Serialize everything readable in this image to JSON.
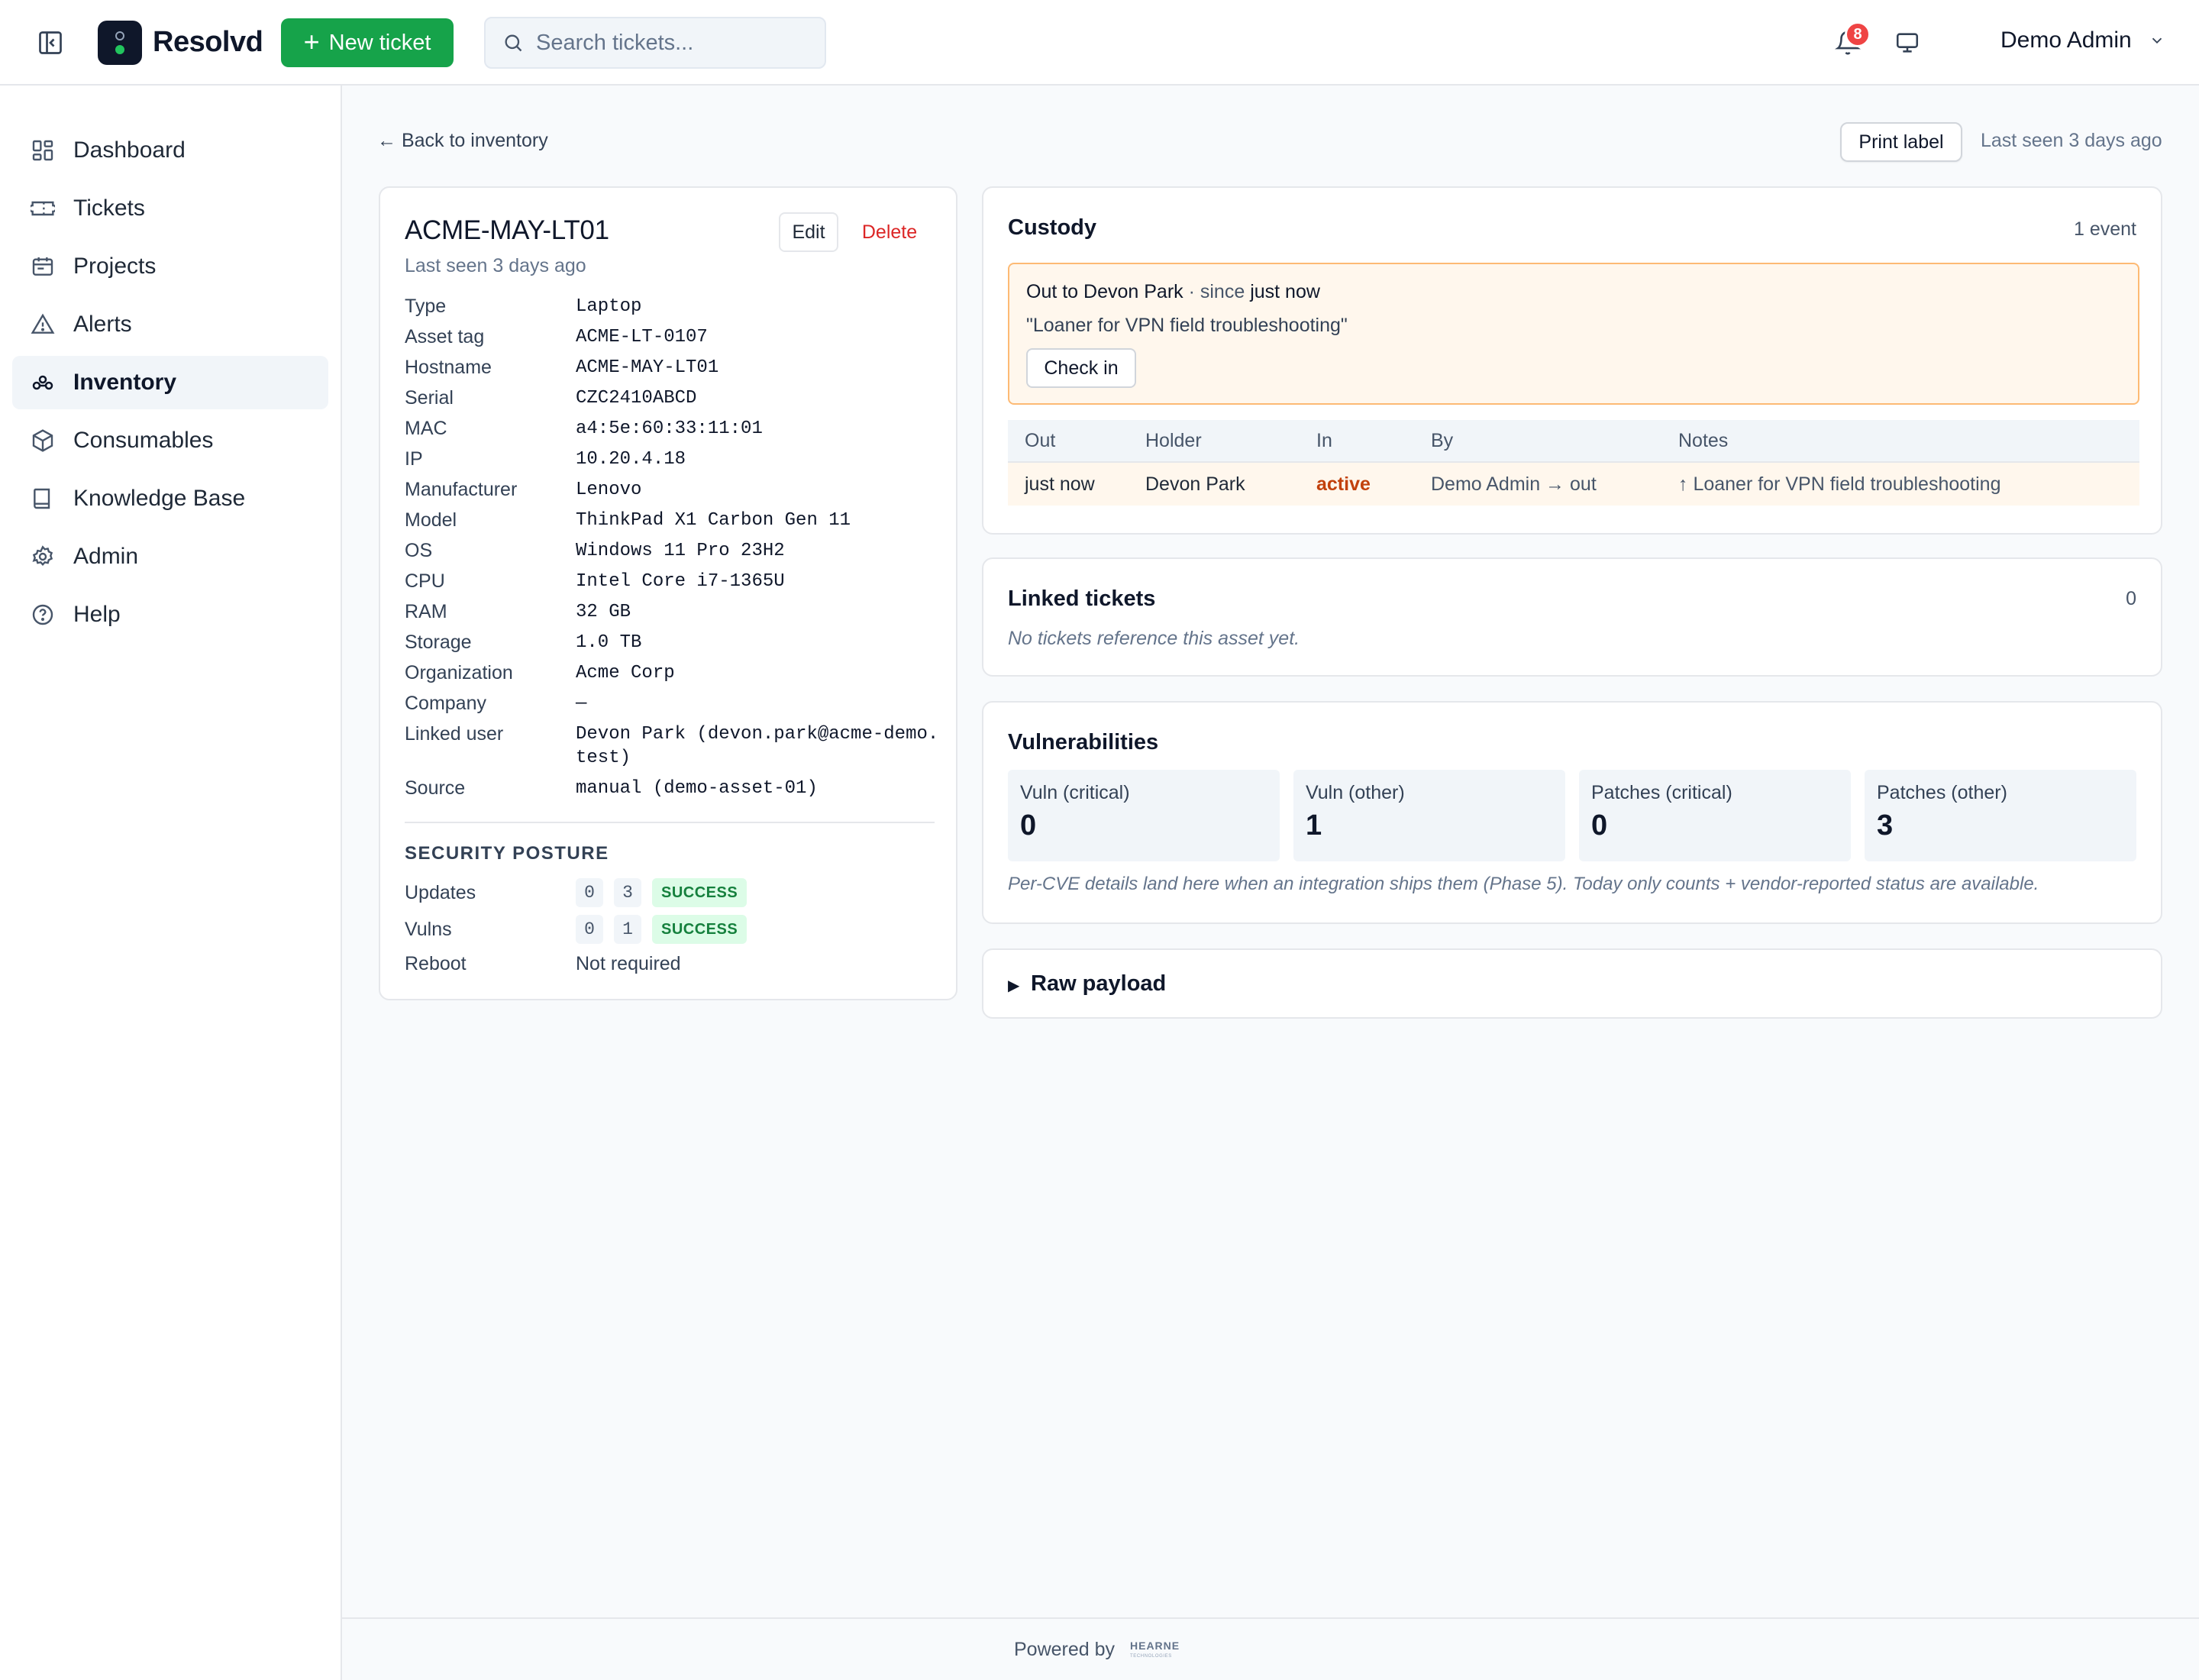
{
  "app": {
    "brand": "Resolvd",
    "new_ticket_label": "New ticket",
    "search_placeholder": "Search tickets...",
    "notification_count": "8",
    "user_name": "Demo Admin",
    "accent_color": "#16a34a"
  },
  "sidebar": {
    "items": [
      {
        "label": "Dashboard",
        "icon": "dashboard-icon"
      },
      {
        "label": "Tickets",
        "icon": "ticket-icon"
      },
      {
        "label": "Projects",
        "icon": "projects-icon"
      },
      {
        "label": "Alerts",
        "icon": "alert-triangle-icon"
      },
      {
        "label": "Inventory",
        "icon": "inventory-icon",
        "active": true
      },
      {
        "label": "Consumables",
        "icon": "box-icon"
      },
      {
        "label": "Knowledge Base",
        "icon": "book-icon"
      },
      {
        "label": "Admin",
        "icon": "gear-icon"
      },
      {
        "label": "Help",
        "icon": "help-icon"
      }
    ]
  },
  "page": {
    "back_label": "← Back to inventory",
    "print_label": "Print label",
    "last_seen": "Last seen 3 days ago"
  },
  "asset": {
    "name": "ACME-MAY-LT01",
    "last_seen": "Last seen 3 days ago",
    "edit_label": "Edit",
    "delete_label": "Delete",
    "props": [
      {
        "k": "Type",
        "v": "Laptop"
      },
      {
        "k": "Asset tag",
        "v": "ACME-LT-0107"
      },
      {
        "k": "Hostname",
        "v": "ACME-MAY-LT01"
      },
      {
        "k": "Serial",
        "v": "CZC2410ABCD"
      },
      {
        "k": "MAC",
        "v": "a4:5e:60:33:11:01"
      },
      {
        "k": "IP",
        "v": "10.20.4.18"
      },
      {
        "k": "Manufacturer",
        "v": "Lenovo"
      },
      {
        "k": "Model",
        "v": "ThinkPad X1 Carbon Gen 11"
      },
      {
        "k": "OS",
        "v": "Windows 11 Pro 23H2"
      },
      {
        "k": "CPU",
        "v": "Intel Core i7-1365U"
      },
      {
        "k": "RAM",
        "v": "32 GB"
      },
      {
        "k": "Storage",
        "v": "1.0 TB"
      },
      {
        "k": "Organization",
        "v": "Acme Corp"
      },
      {
        "k": "Company",
        "v": "—"
      },
      {
        "k": "Linked user",
        "v": "Devon Park (devon.park@acme-demo.test)"
      },
      {
        "k": "Source",
        "v": "manual (demo-asset-01)"
      }
    ],
    "security": {
      "title": "SECURITY POSTURE",
      "updates": {
        "label": "Updates",
        "a": "0",
        "b": "3",
        "status": "SUCCESS"
      },
      "vulns": {
        "label": "Vulns",
        "a": "0",
        "b": "1",
        "status": "SUCCESS"
      },
      "reboot": {
        "label": "Reboot",
        "value": "Not required"
      }
    }
  },
  "custody": {
    "title": "Custody",
    "count": "1 event",
    "banner_prefix": "Out to Devon Park",
    "banner_since": " · since ",
    "banner_when": "just now",
    "banner_note": "\"Loaner for VPN field troubleshooting\"",
    "checkin_label": "Check in",
    "columns": [
      "Out",
      "Holder",
      "In",
      "By",
      "Notes"
    ],
    "rows": [
      {
        "out": "just now",
        "holder": "Devon Park",
        "in": "active",
        "by": "Demo Admin → out",
        "notes": "↑ Loaner for VPN field troubleshooting"
      }
    ]
  },
  "linked": {
    "title": "Linked tickets",
    "count": "0",
    "empty": "No tickets reference this asset yet."
  },
  "vulnerabilities": {
    "title": "Vulnerabilities",
    "stats": [
      {
        "label": "Vuln (critical)",
        "value": "0"
      },
      {
        "label": "Vuln (other)",
        "value": "1"
      },
      {
        "label": "Patches (critical)",
        "value": "0"
      },
      {
        "label": "Patches (other)",
        "value": "3"
      }
    ],
    "note": "Per-CVE details land here when an integration ships them (Phase 5). Today only counts + vendor-reported status are available."
  },
  "raw": {
    "label": "Raw payload"
  },
  "footer": {
    "powered_by": "Powered by",
    "logo_text": "HEARNE",
    "logo_sub": "TECHNOLOGIES"
  }
}
